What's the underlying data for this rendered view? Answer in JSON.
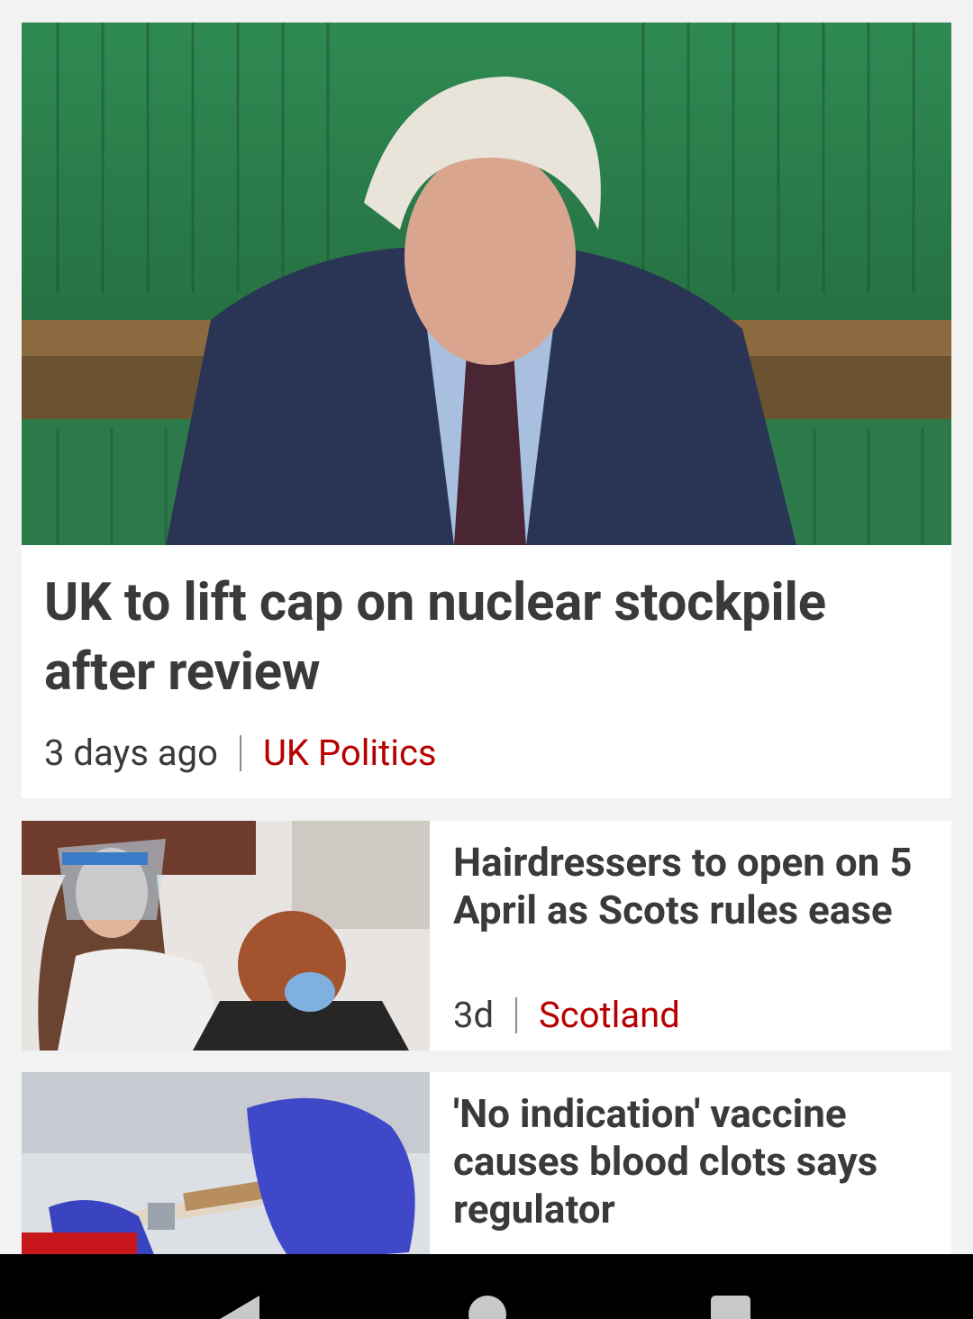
{
  "stories": [
    {
      "title": "UK to lift cap on nuclear stockpile after review",
      "time": "3 days ago",
      "topic": "UK Politics",
      "image": "politician-speaking-commons"
    },
    {
      "title": "Hairdressers to open on 5 April as Scots rules ease",
      "time": "3d",
      "topic": "Scotland",
      "image": "hairdresser-face-shield"
    },
    {
      "title": "'No indication' vaccine causes blood clots says regulator",
      "image": "vaccine-syringe-gloved-hand"
    }
  ],
  "colors": {
    "topic": "#b80000",
    "text": "#3a3a3a",
    "background": "#f2f2f2",
    "card": "#ffffff"
  },
  "navbar": {
    "back_icon": "back-triangle-icon",
    "home_icon": "home-circle-icon",
    "recents_icon": "recents-square-icon"
  }
}
